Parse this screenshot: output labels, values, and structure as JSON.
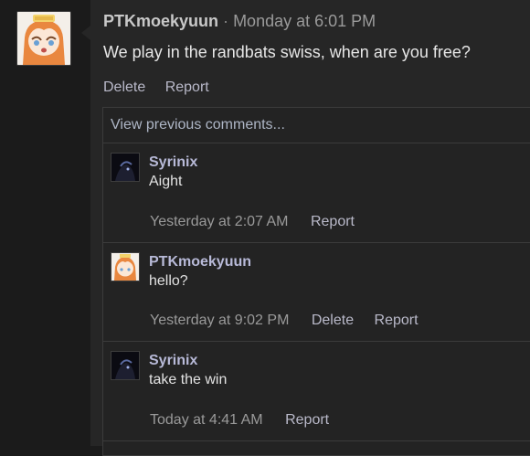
{
  "post": {
    "author": "PTKmoekyuun",
    "separator": "·",
    "time": "Monday at 6:01 PM",
    "body": "We play in the randbats swiss, when are you free?",
    "actions": {
      "delete": "Delete",
      "report": "Report"
    }
  },
  "comments": {
    "view_previous": "View previous comments...",
    "items": [
      {
        "author": "Syrinix",
        "text": "Aight",
        "time": "Yesterday at 2:07 AM",
        "report": "Report"
      },
      {
        "author": "PTKmoekyuun",
        "text": "hello?",
        "time": "Yesterday at 9:02 PM",
        "delete": "Delete",
        "report": "Report"
      },
      {
        "author": "Syrinix",
        "text": "take the win",
        "time": "Today at 4:41 AM",
        "report": "Report"
      }
    ]
  },
  "colors": {
    "background": "#1b1b1b",
    "panel": "#262626",
    "author_name": "#b8bad8",
    "link": "#b9b9c9",
    "muted": "#9a9a9a"
  },
  "icons": [
    "avatar-anime-girl",
    "avatar-dark-character"
  ]
}
